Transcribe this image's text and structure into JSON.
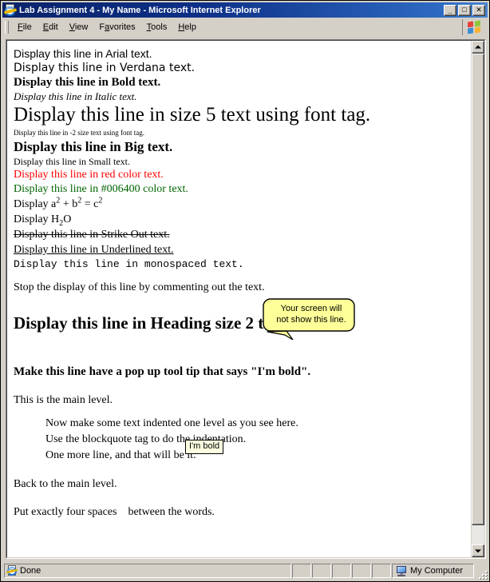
{
  "window": {
    "title": "Lab Assignment 4 - My Name - Microsoft Internet Explorer",
    "icon": "ie-document-icon",
    "buttons": {
      "minimize": "_",
      "maximize": "□",
      "close": "✕"
    }
  },
  "menubar": {
    "items": [
      {
        "label": "File",
        "accel": "F"
      },
      {
        "label": "Edit",
        "accel": "E"
      },
      {
        "label": "View",
        "accel": "V"
      },
      {
        "label": "Favorites",
        "accel": "a"
      },
      {
        "label": "Tools",
        "accel": "T"
      },
      {
        "label": "Help",
        "accel": "H"
      }
    ],
    "logo": "windows-flag-logo"
  },
  "page": {
    "lines": {
      "arial": "Display this line in Arial text.",
      "verdana": "Display this line in Verdana text.",
      "bold": "Display this line in Bold text.",
      "italic": "Display this line in Italic text.",
      "size5": "Display this line in size 5 text using font tag.",
      "size_m2": "Display this line in -2 size text using font tag.",
      "big": "Display this line in Big text.",
      "small": "Display this line in Small text.",
      "red": "Display this line in red color text.",
      "green": "Display this line in #006400 color text.",
      "strike": "Display this line in Strike Out text.",
      "underline": "Display this line in Underlined text.",
      "mono": "Display this line in monospaced text.",
      "comment": "Stop the display of this line by commenting out the text.",
      "heading2": "Display this line in Heading size 2 text.",
      "tooltip_line": "Make this line have a pop up tool tip that says \"I'm bold\".",
      "main_level": "This is the main level.",
      "back_main": "Back to the main level.",
      "four_spaces_before": "Put exactly four spaces",
      "four_spaces_after": "between the words."
    },
    "superscript": {
      "prefix": "Display a",
      "sup1": "2",
      "mid": " + b",
      "sup2": "2",
      "eq": " = c",
      "sup3": "2"
    },
    "subscript": {
      "prefix": "Display H",
      "sub": "2",
      "suffix": "O"
    },
    "blockquote": [
      "Now make some text indented one level as you see here.",
      "Use the blockquote tag to do the indentation.",
      "One more line, and that will be it."
    ],
    "callout": {
      "line1": "Your screen will",
      "line2": "not show this line.",
      "fill": "#FFFF99",
      "stroke": "#000000"
    },
    "tooltip": {
      "text": "I'm bold",
      "fill": "#FFFFE1"
    },
    "colors": {
      "red": "#FF0000",
      "dark_green": "#006400",
      "text": "#000000",
      "background": "#FFFFFF"
    }
  },
  "scrollbar": {
    "up_arrow": "scroll-up-arrow",
    "down_arrow": "scroll-down-arrow"
  },
  "statusbar": {
    "status": "Done",
    "status_icon": "ie-document-icon",
    "zone": "My Computer",
    "zone_icon": "monitor-icon",
    "empty_panes": 5
  }
}
